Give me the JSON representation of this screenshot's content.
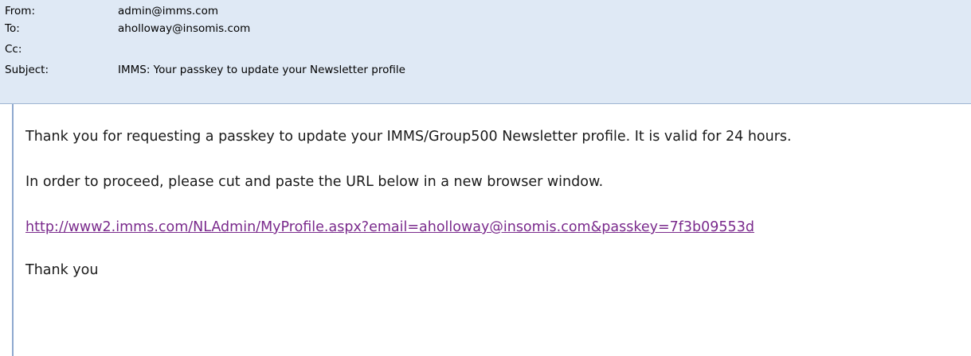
{
  "header": {
    "from_label": "From:",
    "from_value": "admin@imms.com",
    "to_label": "To:",
    "to_value": "aholloway@insomis.com",
    "cc_label": "Cc:",
    "cc_value": "",
    "subject_label": "Subject:",
    "subject_value": "IMMS: Your passkey to update your Newsletter profile"
  },
  "body": {
    "line1": "Thank you for requesting a passkey to update your IMMS/Group500 Newsletter profile. It is valid for 24 hours.",
    "line2": "In order to proceed, please cut and paste the URL below in a new browser window.",
    "link": "http://www2.imms.com/NLAdmin/MyProfile.aspx?email=aholloway@insomis.com&passkey=7f3b09553d",
    "closing": "Thank you"
  },
  "colors": {
    "header_bg": "#dfe9f5",
    "link": "#7a2a8c",
    "body_border": "#8fa9cf"
  }
}
